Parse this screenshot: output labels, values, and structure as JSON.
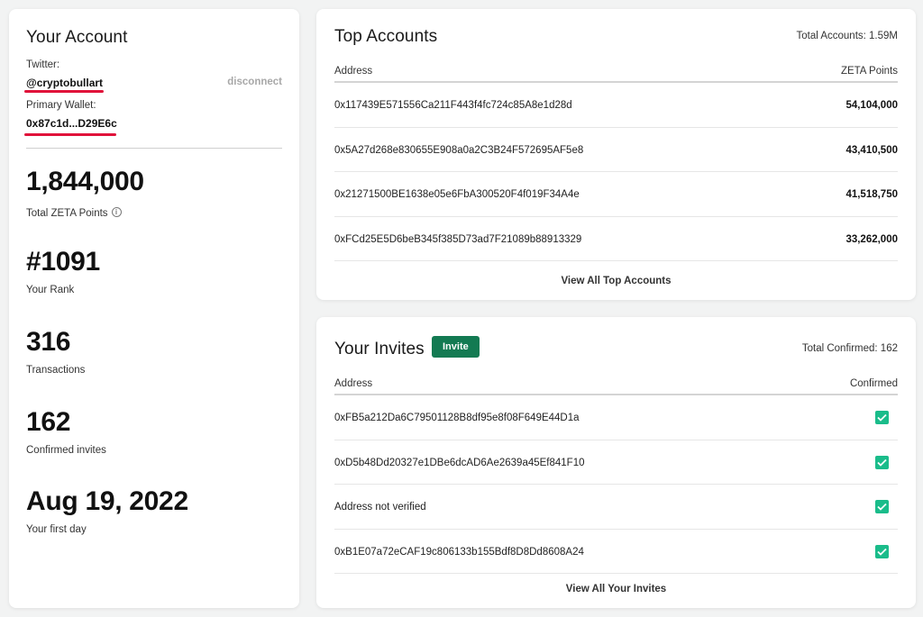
{
  "account": {
    "title": "Your Account",
    "twitter_label": "Twitter:",
    "twitter_handle": "@cryptobullart",
    "disconnect_label": "disconnect",
    "wallet_label": "Primary Wallet:",
    "wallet_address": "0x87c1d...D29E6c",
    "stats": [
      {
        "value": "1,844,000",
        "label": "Total ZETA Points"
      },
      {
        "value": "#1091",
        "label": "Your Rank"
      },
      {
        "value": "316",
        "label": "Transactions"
      },
      {
        "value": "162",
        "label": "Confirmed invites"
      },
      {
        "value": "Aug 19, 2022",
        "label": "Your first day"
      }
    ],
    "underline_color": "#e0123a"
  },
  "top_accounts": {
    "title": "Top Accounts",
    "total": "Total Accounts: 1.59M",
    "columns": [
      "Address",
      "ZETA Points"
    ],
    "rows": [
      {
        "address": "0x117439E571556Ca211F443f4fc724c85A8e1d28d",
        "points": "54,104,000"
      },
      {
        "address": "0x5A27d268e830655E908a0a2C3B24F572695AF5e8",
        "points": "43,410,500"
      },
      {
        "address": "0x21271500BE1638e05e6FbA300520F4f019F34A4e",
        "points": "41,518,750"
      },
      {
        "address": "0xFCd25E5D6beB345f385D73ad7F21089b88913329",
        "points": "33,262,000"
      }
    ],
    "view_all": "View All Top Accounts"
  },
  "invites": {
    "title": "Your Invites",
    "invite_button": "Invite",
    "total": "Total Confirmed: 162",
    "columns": [
      "Address",
      "Confirmed"
    ],
    "rows": [
      {
        "address": "0xFB5a212Da6C79501128B8df95e8f08F649E44D1a",
        "confirmed": true
      },
      {
        "address": "0xD5b48Dd20327e1DBe6dcAD6Ae2639a45Ef841F10",
        "confirmed": true
      },
      {
        "address": "Address not verified",
        "confirmed": true
      },
      {
        "address": "0xB1E07a72eCAF19c806133b155Bdf8D8Dd8608A24",
        "confirmed": true
      }
    ],
    "view_all": "View All Your Invites",
    "accent_color": "#137a52",
    "check_color": "#1abc8a"
  }
}
